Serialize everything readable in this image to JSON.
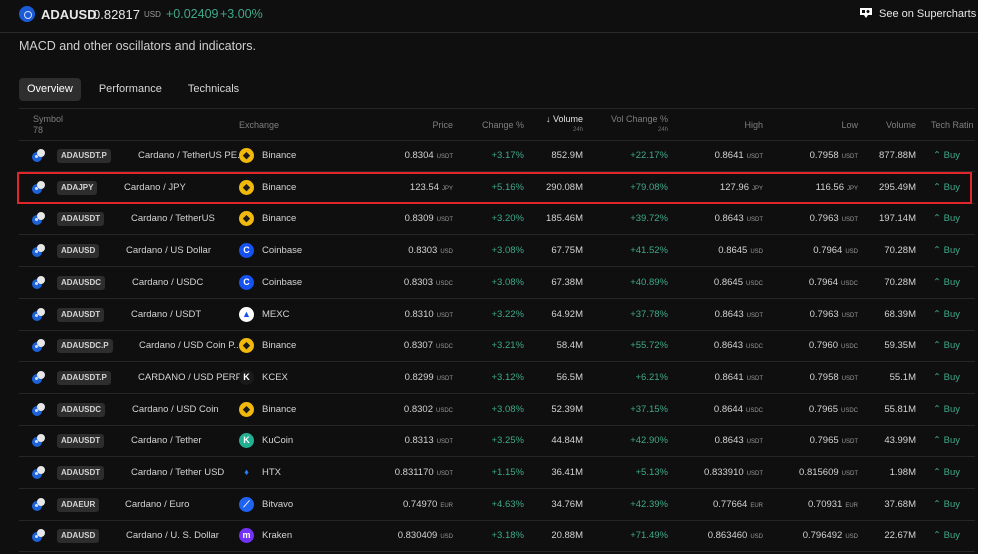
{
  "header": {
    "ticker": "ADAUSD",
    "price": "0.82817",
    "price_unit": "USD",
    "change_abs": "+0.02409",
    "change_pct": "+3.00%",
    "supercharts_link": "See on Supercharts"
  },
  "description": "MACD and other oscillators and indicators.",
  "tabs": [
    {
      "label": "Overview",
      "active": true
    },
    {
      "label": "Performance",
      "active": false
    },
    {
      "label": "Technicals",
      "active": false
    }
  ],
  "table": {
    "columns": {
      "symbol": "Symbol",
      "symbol_count": "78",
      "exchange": "Exchange",
      "price": "Price",
      "change": "Change %",
      "volume": "Volume",
      "volume_sort_icon": "arrow-down",
      "volume_period": "24h",
      "vol_change": "Vol Change %",
      "vol_change_period": "24h",
      "high": "High",
      "low": "Low",
      "volume2": "Volume",
      "tech_rating": "Tech Ratin"
    },
    "rows": [
      {
        "symbol": "ADAUSDT.P",
        "name": "Cardano / TetherUS PE...",
        "exchange": "Binance",
        "exchange_icon": "binance-icon",
        "price": "0.8304",
        "price_unit": "USDT",
        "change": "+3.17%",
        "volume": "852.9M",
        "vol_change": "+22.17%",
        "high": "0.8641",
        "high_unit": "USDT",
        "low": "0.7958",
        "low_unit": "USDT",
        "volume2": "877.88M",
        "rating": "Buy"
      },
      {
        "symbol": "ADAJPY",
        "name": "Cardano / JPY",
        "exchange": "Binance",
        "exchange_icon": "binance-icon",
        "price": "123.54",
        "price_unit": "JPY",
        "change": "+5.16%",
        "volume": "290.08M",
        "vol_change": "+79.08%",
        "high": "127.96",
        "high_unit": "JPY",
        "low": "116.56",
        "low_unit": "JPY",
        "volume2": "295.49M",
        "rating": "Buy",
        "highlighted": true
      },
      {
        "symbol": "ADAUSDT",
        "name": "Cardano / TetherUS",
        "exchange": "Binance",
        "exchange_icon": "binance-icon",
        "price": "0.8309",
        "price_unit": "USDT",
        "change": "+3.20%",
        "volume": "185.46M",
        "vol_change": "+39.72%",
        "high": "0.8643",
        "high_unit": "USDT",
        "low": "0.7963",
        "low_unit": "USDT",
        "volume2": "197.14M",
        "rating": "Buy"
      },
      {
        "symbol": "ADAUSD",
        "name": "Cardano / US Dollar",
        "exchange": "Coinbase",
        "exchange_icon": "coinbase-icon",
        "price": "0.8303",
        "price_unit": "USD",
        "change": "+3.08%",
        "volume": "67.75M",
        "vol_change": "+41.52%",
        "high": "0.8645",
        "high_unit": "USD",
        "low": "0.7964",
        "low_unit": "USD",
        "volume2": "70.28M",
        "rating": "Buy"
      },
      {
        "symbol": "ADAUSDC",
        "name": "Cardano / USDC",
        "exchange": "Coinbase",
        "exchange_icon": "coinbase-icon",
        "price": "0.8303",
        "price_unit": "USDC",
        "change": "+3.08%",
        "volume": "67.38M",
        "vol_change": "+40.89%",
        "high": "0.8645",
        "high_unit": "USDC",
        "low": "0.7964",
        "low_unit": "USDC",
        "volume2": "70.28M",
        "rating": "Buy"
      },
      {
        "symbol": "ADAUSDT",
        "name": "Cardano / USDT",
        "exchange": "MEXC",
        "exchange_icon": "mexc-icon",
        "price": "0.8310",
        "price_unit": "USDT",
        "change": "+3.22%",
        "volume": "64.92M",
        "vol_change": "+37.78%",
        "high": "0.8643",
        "high_unit": "USDT",
        "low": "0.7963",
        "low_unit": "USDT",
        "volume2": "68.39M",
        "rating": "Buy"
      },
      {
        "symbol": "ADAUSDC.P",
        "name": "Cardano / USD Coin P...",
        "exchange": "Binance",
        "exchange_icon": "binance-icon",
        "price": "0.8307",
        "price_unit": "USDC",
        "change": "+3.21%",
        "volume": "58.4M",
        "vol_change": "+55.72%",
        "high": "0.8643",
        "high_unit": "USDC",
        "low": "0.7960",
        "low_unit": "USDC",
        "volume2": "59.35M",
        "rating": "Buy"
      },
      {
        "symbol": "ADAUSDT.P",
        "name": "CARDANO / USD PERP...",
        "exchange": "KCEX",
        "exchange_icon": "kcex-icon",
        "price": "0.8299",
        "price_unit": "USDT",
        "change": "+3.12%",
        "volume": "56.5M",
        "vol_change": "+6.21%",
        "high": "0.8641",
        "high_unit": "USDT",
        "low": "0.7958",
        "low_unit": "USDT",
        "volume2": "55.1M",
        "rating": "Buy"
      },
      {
        "symbol": "ADAUSDC",
        "name": "Cardano / USD Coin",
        "exchange": "Binance",
        "exchange_icon": "binance-icon",
        "price": "0.8302",
        "price_unit": "USDC",
        "change": "+3.08%",
        "volume": "52.39M",
        "vol_change": "+37.15%",
        "high": "0.8644",
        "high_unit": "USDC",
        "low": "0.7965",
        "low_unit": "USDC",
        "volume2": "55.81M",
        "rating": "Buy"
      },
      {
        "symbol": "ADAUSDT",
        "name": "Cardano / Tether",
        "exchange": "KuCoin",
        "exchange_icon": "kucoin-icon",
        "price": "0.8313",
        "price_unit": "USDT",
        "change": "+3.25%",
        "volume": "44.84M",
        "vol_change": "+42.90%",
        "high": "0.8643",
        "high_unit": "USDT",
        "low": "0.7965",
        "low_unit": "USDT",
        "volume2": "43.99M",
        "rating": "Buy"
      },
      {
        "symbol": "ADAUSDT",
        "name": "Cardano / Tether USD",
        "exchange": "HTX",
        "exchange_icon": "htx-icon",
        "price": "0.831170",
        "price_unit": "USDT",
        "change": "+1.15%",
        "volume": "36.41M",
        "vol_change": "+5.13%",
        "high": "0.833910",
        "high_unit": "USDT",
        "low": "0.815609",
        "low_unit": "USDT",
        "volume2": "1.98M",
        "rating": "Buy"
      },
      {
        "symbol": "ADAEUR",
        "name": "Cardano / Euro",
        "exchange": "Bitvavo",
        "exchange_icon": "bitvavo-icon",
        "price": "0.74970",
        "price_unit": "EUR",
        "change": "+4.63%",
        "volume": "34.76M",
        "vol_change": "+42.39%",
        "high": "0.77664",
        "high_unit": "EUR",
        "low": "0.70931",
        "low_unit": "EUR",
        "volume2": "37.68M",
        "rating": "Buy"
      },
      {
        "symbol": "ADAUSD",
        "name": "Cardano / U. S. Dollar",
        "exchange": "Kraken",
        "exchange_icon": "kraken-icon",
        "price": "0.830409",
        "price_unit": "USD",
        "change": "+3.18%",
        "volume": "20.88M",
        "vol_change": "+71.49%",
        "high": "0.863460",
        "high_unit": "USD",
        "low": "0.796492",
        "low_unit": "USD",
        "volume2": "22.67M",
        "rating": "Buy"
      }
    ]
  },
  "colors": {
    "background": "#0f0f0f",
    "positive": "#3fa88a",
    "highlight_border": "#e0262b",
    "binance": "#f0b90b",
    "coinbase": "#1652f0"
  }
}
